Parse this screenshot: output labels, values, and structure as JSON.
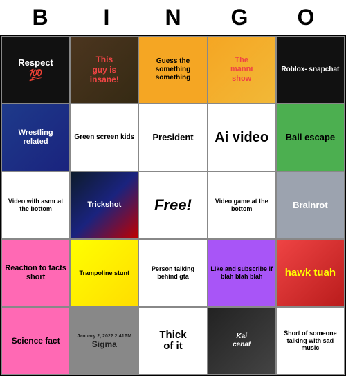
{
  "header": {
    "letters": [
      "B",
      "I",
      "N",
      "G",
      "O"
    ]
  },
  "grid": [
    {
      "row": 0,
      "cells": [
        {
          "id": "r0c0",
          "text": "Respect\n💯",
          "style": "respect-cell",
          "class": "bg-black"
        },
        {
          "id": "r0c1",
          "text": "This guy is insane",
          "style": "this-guy-cell",
          "textColor": "red"
        },
        {
          "id": "r0c2",
          "text": "Guess the something something",
          "style": "guess-cell"
        },
        {
          "id": "r0c3",
          "text": "The manni show",
          "style": "the-manni-cell"
        },
        {
          "id": "r0c4",
          "text": "Roblox- snapchat",
          "style": "roblox-cell"
        }
      ]
    },
    {
      "row": 1,
      "cells": [
        {
          "id": "r1c0",
          "text": "Wrestling related",
          "style": "wrestling-cell"
        },
        {
          "id": "r1c1",
          "text": "Green screen kids",
          "style": "green-screen-cell"
        },
        {
          "id": "r1c2",
          "text": "President",
          "style": "president-cell"
        },
        {
          "id": "r1c3",
          "text": "Ai video",
          "style": "ai-video-cell"
        },
        {
          "id": "r1c4",
          "text": "Ball escape",
          "style": "ball-escape-cell"
        }
      ]
    },
    {
      "row": 2,
      "cells": [
        {
          "id": "r2c0",
          "text": "Video with asmr at the bottom",
          "style": "video-with-asmr-cell"
        },
        {
          "id": "r2c1",
          "text": "Trickshot",
          "style": "trickshot-cell"
        },
        {
          "id": "r2c2",
          "text": "Free!",
          "style": "free-cell"
        },
        {
          "id": "r2c3",
          "text": "Video game at the bottom",
          "style": "video-game-bottom-cell"
        },
        {
          "id": "r2c4",
          "text": "Brainrot",
          "style": "brainrot-cell"
        }
      ]
    },
    {
      "row": 3,
      "cells": [
        {
          "id": "r3c0",
          "text": "Reaction to facts short",
          "style": "reaction-cell"
        },
        {
          "id": "r3c1",
          "text": "Trampoline stunt",
          "style": "trampoline-cell"
        },
        {
          "id": "r3c2",
          "text": "Person talking behind gta",
          "style": "person-talking-cell"
        },
        {
          "id": "r3c3",
          "text": "Like and subscribe if blah blah blah",
          "style": "like-subscribe-cell"
        },
        {
          "id": "r3c4",
          "text": "hawk tuah",
          "style": "hawk-tuah-cell"
        }
      ]
    },
    {
      "row": 4,
      "cells": [
        {
          "id": "r4c0",
          "text": "Science fact",
          "style": "science-fact-cell"
        },
        {
          "id": "r4c1",
          "text": "January 2, 2022  2:41PM\nSigma",
          "style": "sigma-cell"
        },
        {
          "id": "r4c2",
          "text": "Thick of it",
          "style": "thick-cell"
        },
        {
          "id": "r4c3",
          "text": "Kai cenat",
          "style": "kai-cenat-cell"
        },
        {
          "id": "r4c4",
          "text": "Short of someone talking with sad music",
          "style": "short-of-someone-cell"
        }
      ]
    }
  ]
}
